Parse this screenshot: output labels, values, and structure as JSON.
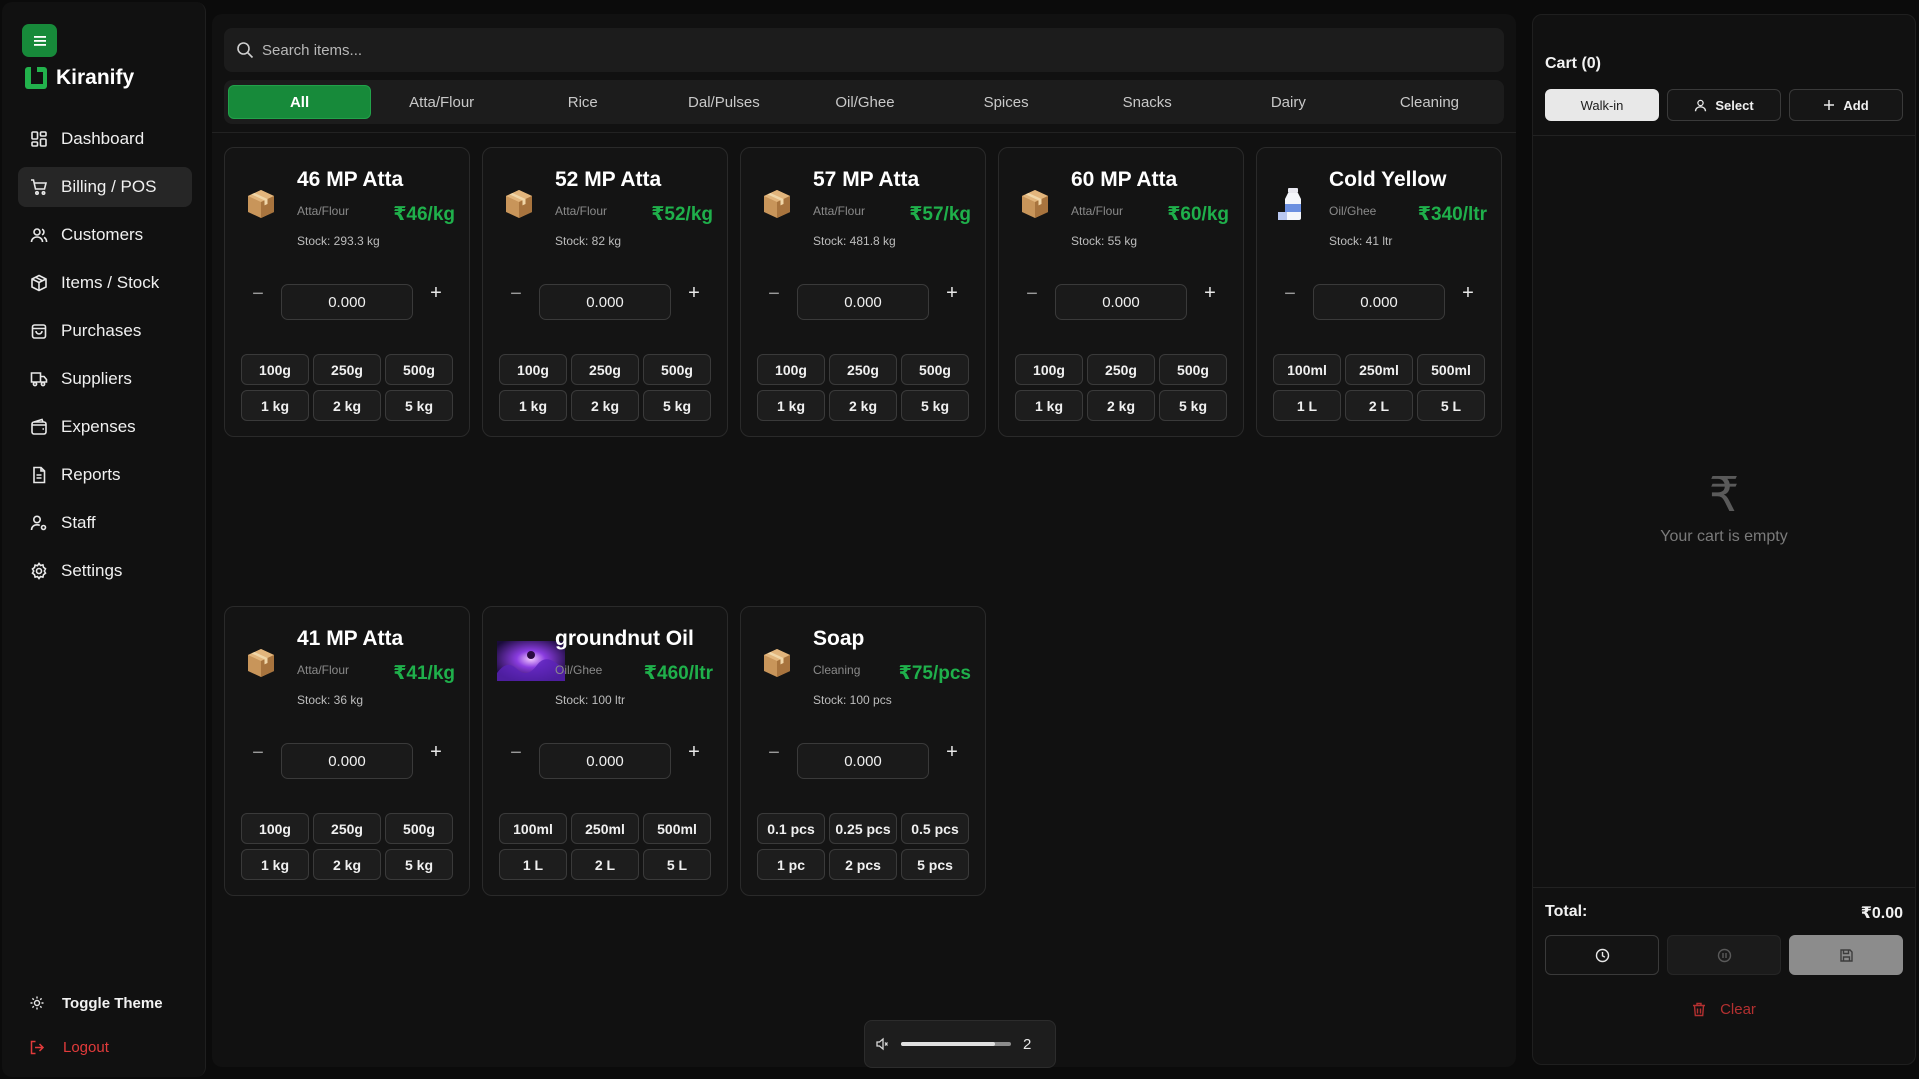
{
  "sidebar": {
    "brand": "Kiranify",
    "accent": "#178a3a",
    "items": [
      {
        "label": "Dashboard",
        "icon": "dashboard-icon"
      },
      {
        "label": "Billing / POS",
        "icon": "cart-icon",
        "active": true
      },
      {
        "label": "Customers",
        "icon": "users-icon"
      },
      {
        "label": "Items / Stock",
        "icon": "package-icon"
      },
      {
        "label": "Purchases",
        "icon": "shopping-bag-icon"
      },
      {
        "label": "Suppliers",
        "icon": "truck-icon"
      },
      {
        "label": "Expenses",
        "icon": "wallet-icon"
      },
      {
        "label": "Reports",
        "icon": "file-text-icon"
      },
      {
        "label": "Staff",
        "icon": "user-cog-icon"
      },
      {
        "label": "Settings",
        "icon": "gear-icon"
      }
    ],
    "toggle_theme": "Toggle Theme",
    "logout": "Logout"
  },
  "search": {
    "placeholder": "Search items..."
  },
  "categories": [
    {
      "label": "All",
      "active": true
    },
    {
      "label": "Atta/Flour"
    },
    {
      "label": "Rice"
    },
    {
      "label": "Dal/Pulses"
    },
    {
      "label": "Oil/Ghee"
    },
    {
      "label": "Spices"
    },
    {
      "label": "Snacks"
    },
    {
      "label": "Dairy"
    },
    {
      "label": "Cleaning"
    }
  ],
  "products": [
    {
      "name": "46 MP Atta",
      "category": "Atta/Flour",
      "price": "₹46/kg",
      "stock": "Stock: 293.3 kg",
      "qty": "0.000",
      "icon": "package-box-icon",
      "presets": [
        "100g",
        "250g",
        "500g",
        "1 kg",
        "2 kg",
        "5 kg"
      ]
    },
    {
      "name": "52 MP Atta",
      "category": "Atta/Flour",
      "price": "₹52/kg",
      "stock": "Stock: 82 kg",
      "qty": "0.000",
      "icon": "package-box-icon",
      "presets": [
        "100g",
        "250g",
        "500g",
        "1 kg",
        "2 kg",
        "5 kg"
      ]
    },
    {
      "name": "57 MP Atta",
      "category": "Atta/Flour",
      "price": "₹57/kg",
      "stock": "Stock: 481.8 kg",
      "qty": "0.000",
      "icon": "package-box-icon",
      "presets": [
        "100g",
        "250g",
        "500g",
        "1 kg",
        "2 kg",
        "5 kg"
      ]
    },
    {
      "name": "60 MP Atta",
      "category": "Atta/Flour",
      "price": "₹60/kg",
      "stock": "Stock: 55 kg",
      "qty": "0.000",
      "icon": "package-box-icon",
      "presets": [
        "100g",
        "250g",
        "500g",
        "1 kg",
        "2 kg",
        "5 kg"
      ]
    },
    {
      "name": "Cold Yellow",
      "category": "Oil/Ghee",
      "price": "₹340/ltr",
      "stock": "Stock: 41 ltr",
      "qty": "0.000",
      "icon": "milk-bottle-icon",
      "presets": [
        "100ml",
        "250ml",
        "500ml",
        "1 L",
        "2 L",
        "5 L"
      ]
    },
    {
      "name": "41 MP Atta",
      "category": "Atta/Flour",
      "price": "₹41/kg",
      "stock": "Stock: 36 kg",
      "qty": "0.000",
      "icon": "package-box-icon",
      "presets": [
        "100g",
        "250g",
        "500g",
        "1 kg",
        "2 kg",
        "5 kg"
      ]
    },
    {
      "name": "groundnut Oil",
      "category": "Oil/Ghee",
      "price": "₹460/ltr",
      "stock": "Stock: 100 ltr",
      "qty": "0.000",
      "icon": "product-photo",
      "presets": [
        "100ml",
        "250ml",
        "500ml",
        "1 L",
        "2 L",
        "5 L"
      ]
    },
    {
      "name": "Soap",
      "category": "Cleaning",
      "price": "₹75/pcs",
      "stock": "Stock: 100 pcs",
      "qty": "0.000",
      "icon": "package-box-icon",
      "presets": [
        "0.1 pcs",
        "0.25 pcs",
        "0.5 pcs",
        "1 pc",
        "2 pcs",
        "5 pcs"
      ]
    }
  ],
  "volume": {
    "value": "2",
    "level": 0.85
  },
  "cart": {
    "title": "Cart (0)",
    "walkin": "Walk-in",
    "select": "Select",
    "add": "Add",
    "empty_symbol": "₹",
    "empty_text": "Your cart is empty",
    "total_label": "Total:",
    "total_value": "₹0.00",
    "clear": "Clear"
  },
  "colors": {
    "price": "#1fb04b",
    "danger": "#e23b3b",
    "accent": "#178a3a"
  }
}
